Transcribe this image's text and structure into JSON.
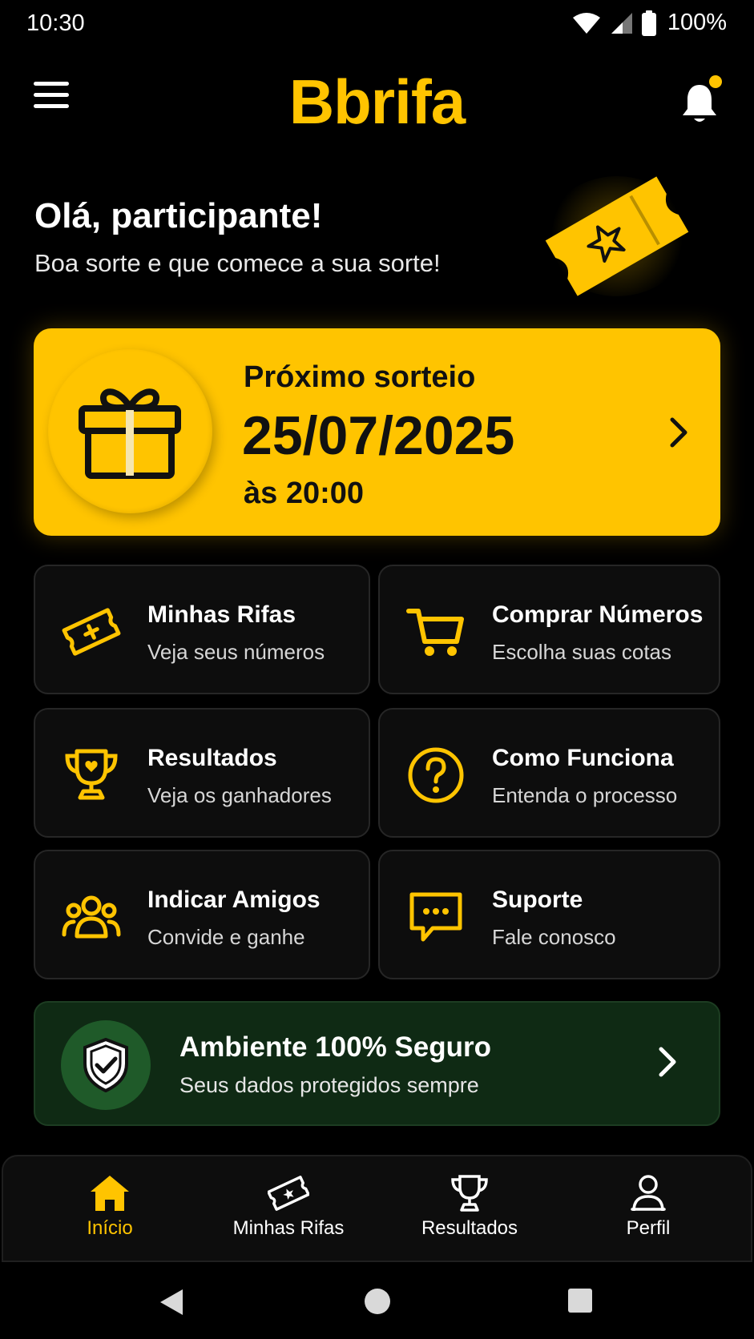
{
  "status_bar": {
    "time": "10:30",
    "battery": "100%"
  },
  "header": {
    "title": "Bbrifa",
    "icons": [
      "menu-icon",
      "bell-icon"
    ]
  },
  "greeting": {
    "title": "Olá, participante!",
    "subtitle": "Boa sorte e que comece a sua sorte!"
  },
  "next_draw": {
    "label": "Próximo sorteio",
    "date": "25/07/2025",
    "time": "às 20:00"
  },
  "tiles": [
    {
      "title": "Minhas Rifas",
      "subtitle": "Veja seus números",
      "icon": "ticket-icon"
    },
    {
      "title": "Comprar Números",
      "subtitle": "Escolha suas cotas",
      "icon": "cart-icon"
    },
    {
      "title": "Resultados",
      "subtitle": "Veja os ganhadores",
      "icon": "trophy-icon"
    },
    {
      "title": "Como Funciona",
      "subtitle": "Entenda o processo",
      "icon": "help-icon"
    },
    {
      "title": "Indicar Amigos",
      "subtitle": "Convide e ganhe",
      "icon": "users-icon"
    },
    {
      "title": "Suporte",
      "subtitle": "Fale conosco",
      "icon": "chat-icon"
    }
  ],
  "secure": {
    "title": "Ambiente 100% Seguro",
    "subtitle": "Seus dados protegidos sempre"
  },
  "bottom_nav": [
    {
      "label": "Início",
      "icon": "home-icon",
      "active": true
    },
    {
      "label": "Minhas Rifas",
      "icon": "ticket-icon",
      "active": false
    },
    {
      "label": "Resultados",
      "icon": "trophy-icon",
      "active": false
    },
    {
      "label": "Perfil",
      "icon": "user-icon",
      "active": false
    }
  ],
  "colors": {
    "accent": "#FFC400",
    "background": "#000000",
    "card": "#0d0d0d",
    "secure_bg": "#0f2a14",
    "secure_icon_bg": "#1f5a29"
  }
}
